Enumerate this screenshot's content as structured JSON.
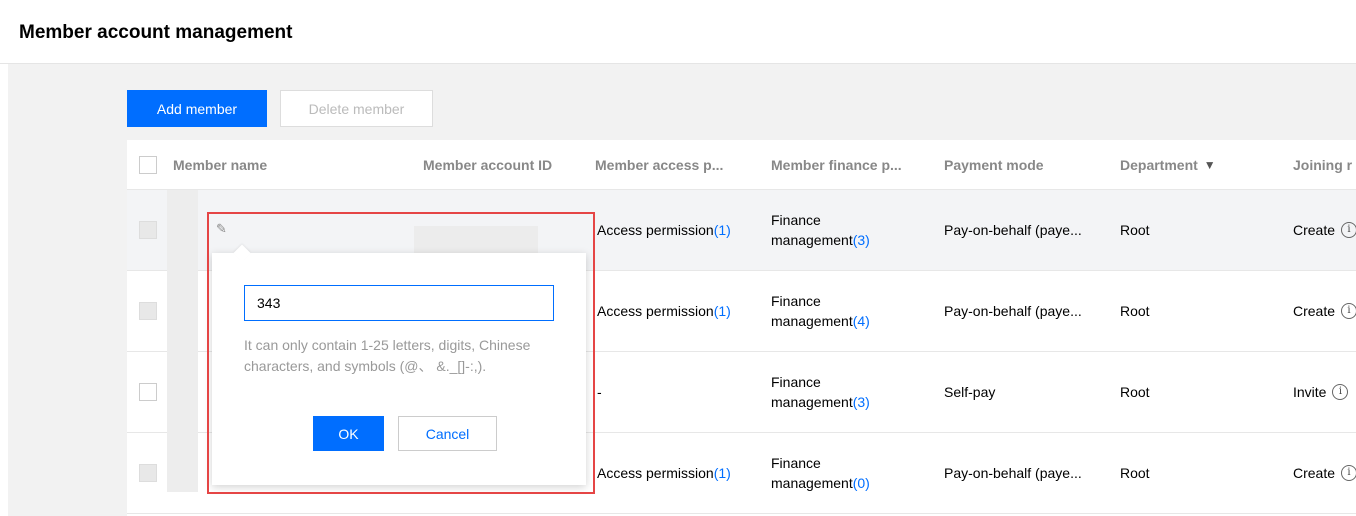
{
  "page": {
    "title": "Member account management"
  },
  "toolbar": {
    "add_label": "Add member",
    "delete_label": "Delete member"
  },
  "table": {
    "columns": [
      "Member name",
      "Member account ID",
      "Member access p...",
      "Member finance p...",
      "Payment mode",
      "Department",
      "Joining r"
    ],
    "rows": [
      {
        "access_text": "Access permission",
        "access_count": "(1)",
        "finance_line1": "Finance",
        "finance_text": "management",
        "finance_count": "(3)",
        "payment": "Pay-on-behalf (paye...",
        "department": "Root",
        "joining": "Create"
      },
      {
        "access_text": "Access permission",
        "access_count": "(1)",
        "finance_line1": "Finance",
        "finance_text": "management",
        "finance_count": "(4)",
        "payment": "Pay-on-behalf (paye...",
        "department": "Root",
        "joining": "Create"
      },
      {
        "access_text": "-",
        "access_count": "",
        "finance_line1": "Finance",
        "finance_text": "management",
        "finance_count": "(3)",
        "payment": "Self-pay",
        "department": "Root",
        "joining": "Invite"
      },
      {
        "access_text": "Access permission",
        "access_count": "(1)",
        "finance_line1": "Finance",
        "finance_text": "management",
        "finance_count": "(0)",
        "payment": "Pay-on-behalf (paye...",
        "department": "Root",
        "joining": "Create"
      }
    ]
  },
  "popup": {
    "input_value": "343",
    "hint": "It can only contain 1-25 letters, digits, Chinese characters, and symbols (@、 &._[]-:,).",
    "ok_label": "OK",
    "cancel_label": "Cancel"
  },
  "icons": {
    "edit": "pencil-icon",
    "filter": "filter-icon",
    "info": "info-icon"
  },
  "colors": {
    "accent": "#006eff",
    "highlight_frame": "#e54545"
  }
}
